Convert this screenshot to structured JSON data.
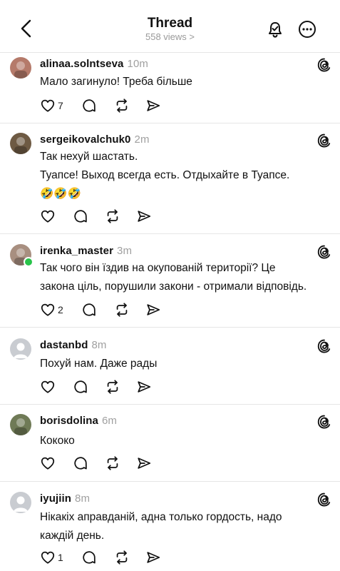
{
  "header": {
    "title": "Thread",
    "views": "558 views >"
  },
  "posts": [
    {
      "username": "alinaa.solntseva",
      "time": "10m",
      "text": "Мало загинуло! Треба більше",
      "likes": "7",
      "avatar_color": "#b57a6a"
    },
    {
      "username": "sergeikovalchuk0",
      "time": "2m",
      "text": "Так нехуй шастать.\n Туапсе!  Выход всегда есть. Отдыхайте в Туапсе.\n🤣🤣🤣",
      "likes": "",
      "avatar_color": "#6e5a43"
    },
    {
      "username": "irenka_master",
      "time": "3m",
      "text": "Так чого він їздив на окупованій території? Це\nзаконa ціль, порушили закони - отримали відповідь.",
      "likes": "2",
      "avatar_color": "#a88f80"
    },
    {
      "username": "dastanbd",
      "time": "8m",
      "text": "Похуй нам. Даже рады",
      "likes": "",
      "avatar_color": "#c9ccd1"
    },
    {
      "username": "borisdolina",
      "time": "6m",
      "text": "Кококо",
      "likes": "",
      "avatar_color": "#6f7a56"
    },
    {
      "username": "iyujiin",
      "time": "8m",
      "text": "Нікакіх апрaвданій, адна только гордость, надо\nкаждій день.",
      "likes": "1",
      "avatar_color": "#c9ccd1"
    }
  ],
  "colors": {
    "muted": "#a0a0a0",
    "online": "#28c34a",
    "divider": "#e6e6e6"
  }
}
